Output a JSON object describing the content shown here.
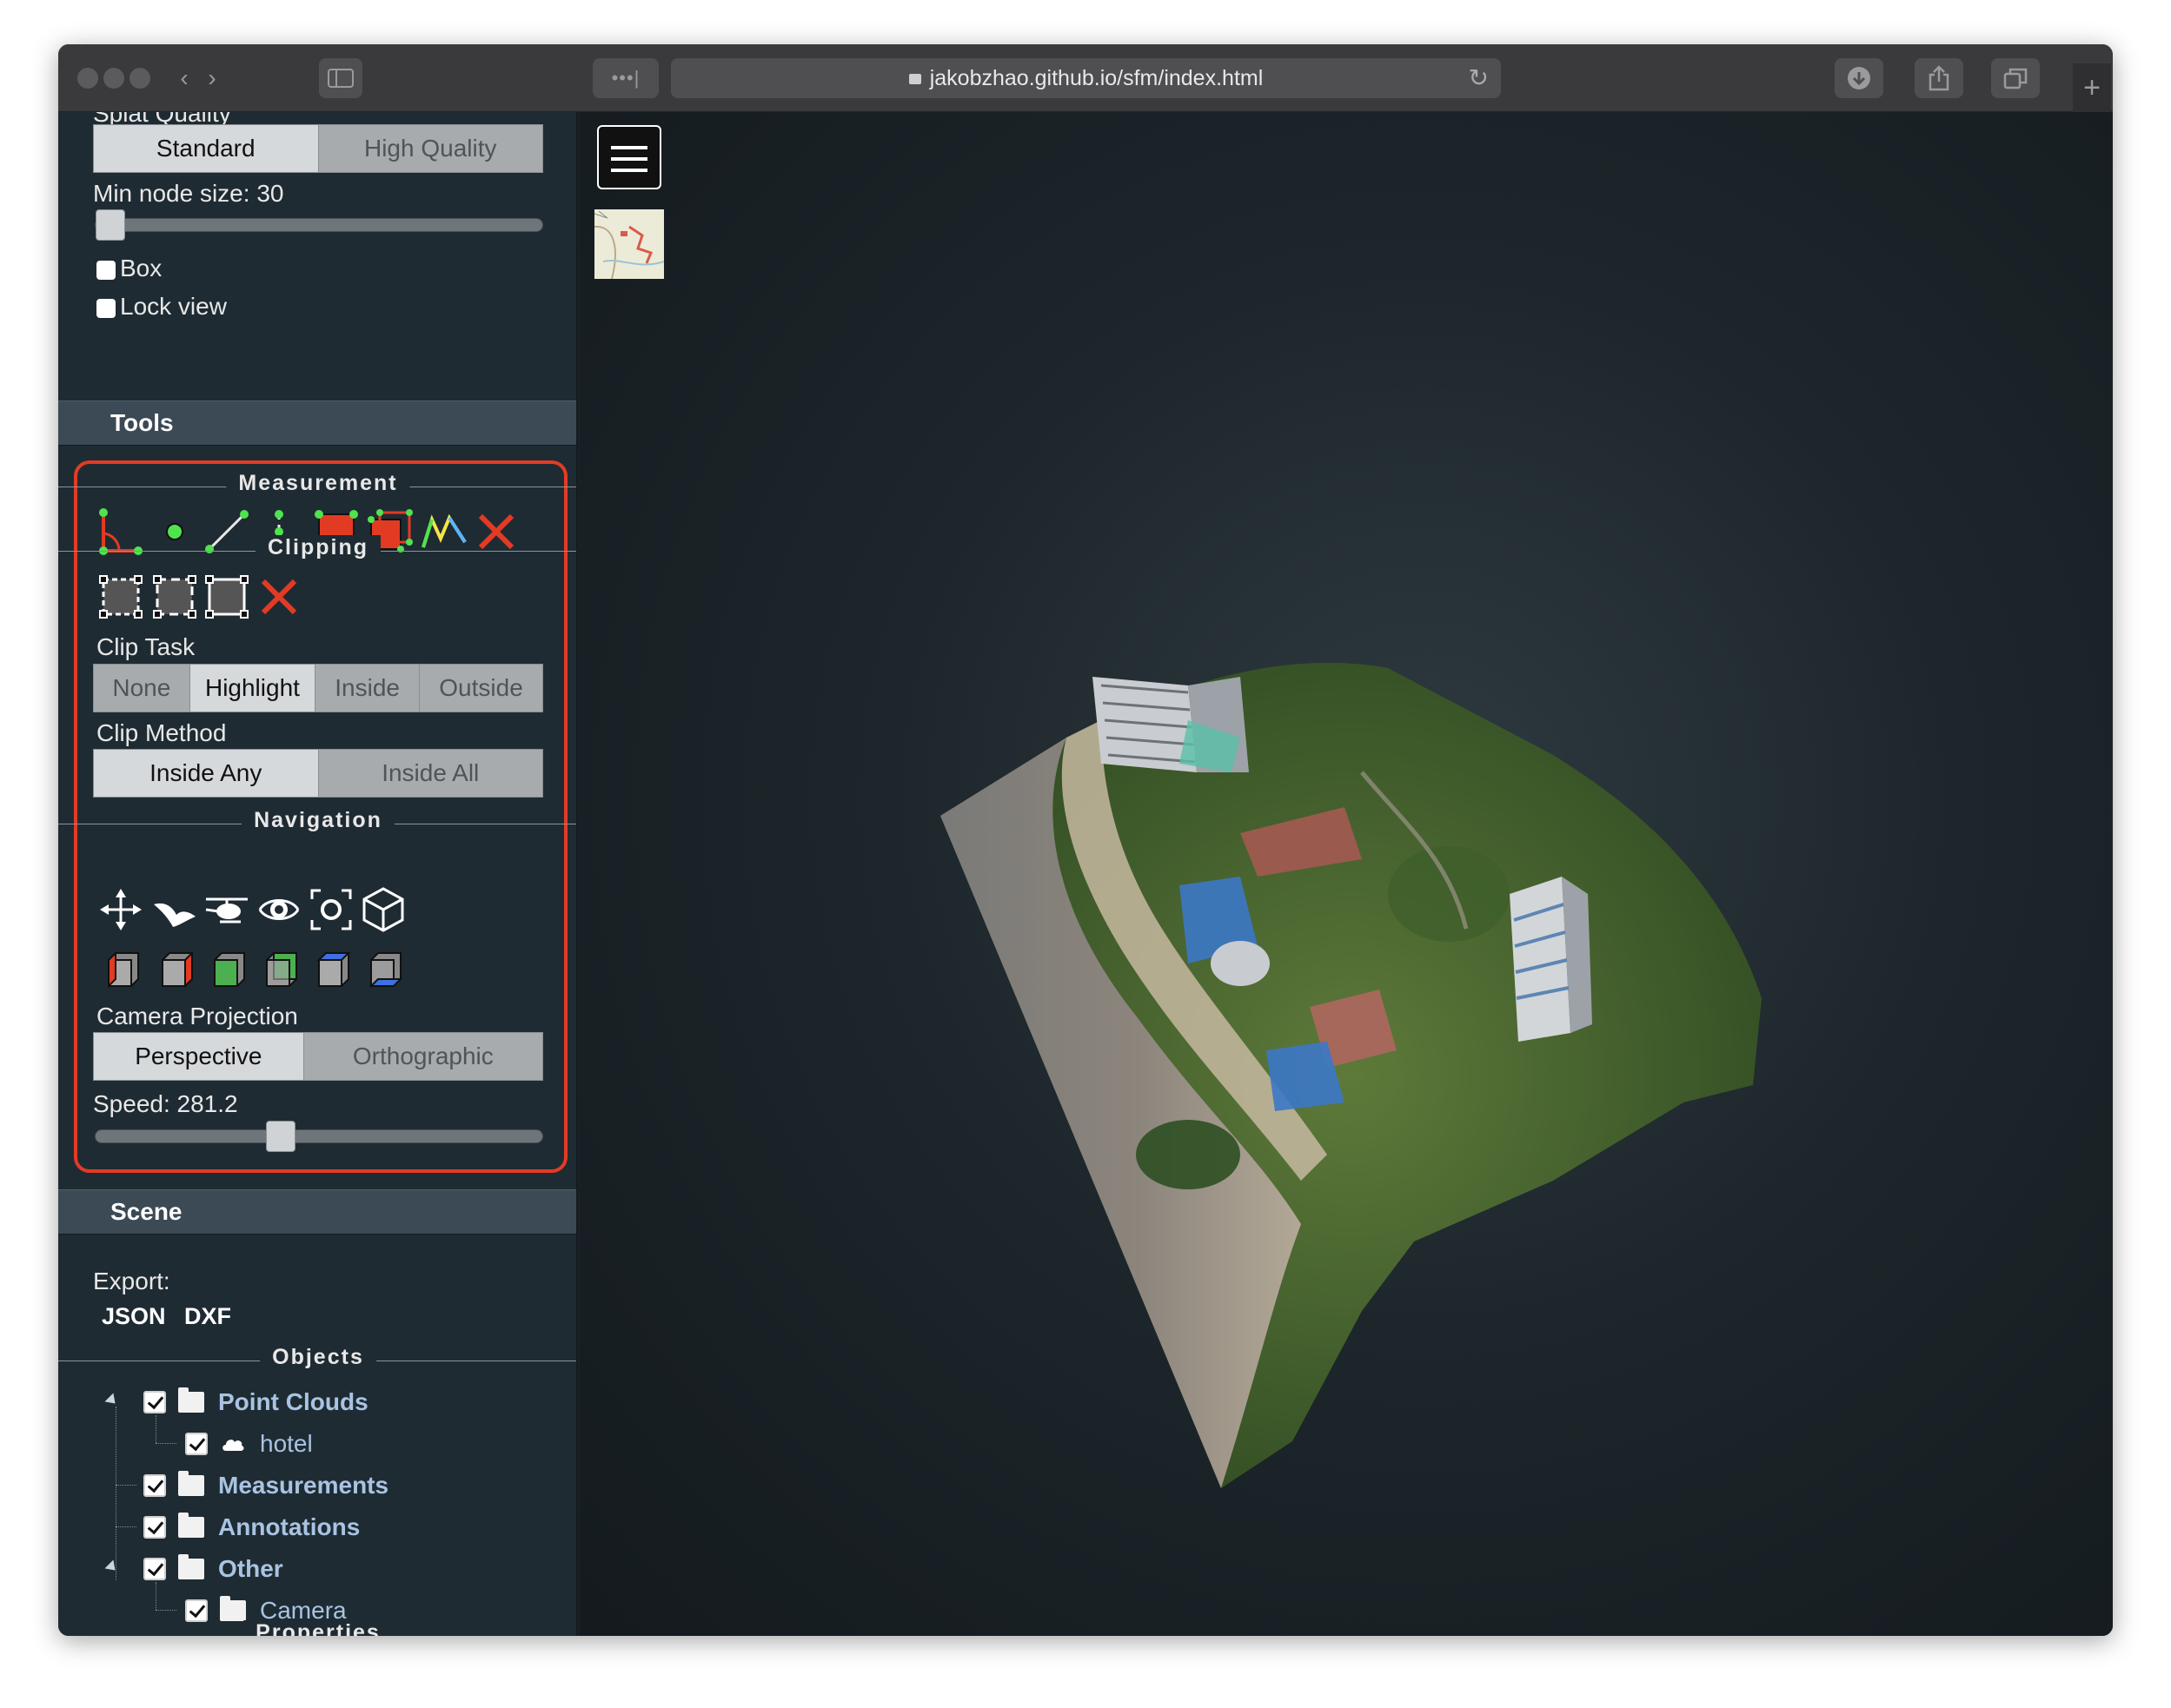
{
  "browser": {
    "url": "jakobzhao.github.io/sfm/index.html",
    "reader_icon": "•••|",
    "nav_back_icon": "‹",
    "nav_forward_icon": "›"
  },
  "sidebar": {
    "splat_quality": {
      "label": "Splat Quality",
      "options": [
        "Standard",
        "High Quality"
      ],
      "selected": "Standard"
    },
    "min_node_size": {
      "label": "Min node size: 30",
      "value": 30,
      "slider_fraction": 0.03
    },
    "box_label": "Box",
    "lock_view_label": "Lock view",
    "tools_header": "Tools",
    "measurement_title": "Measurement",
    "measurement_icons": [
      "angle-icon",
      "point-icon",
      "distance-icon",
      "height-icon",
      "area-icon",
      "volume-icon",
      "profile-icon",
      "remove-measurements-icon"
    ],
    "clipping_title": "Clipping",
    "clipping_icons": [
      "clip-volume-icon",
      "clip-polygon-icon",
      "clip-screen-box-icon",
      "remove-clipping-icon"
    ],
    "clip_task": {
      "label": "Clip Task",
      "options": [
        "None",
        "Highlight",
        "Inside",
        "Outside"
      ],
      "selected": "Highlight"
    },
    "clip_method": {
      "label": "Clip Method",
      "options": [
        "Inside Any",
        "Inside All"
      ],
      "selected": "Inside Any"
    },
    "navigation_title": "Navigation",
    "navigation_icons": [
      "earth-controls-icon",
      "fly-controls-icon",
      "helicopter-controls-icon",
      "orbit-controls-icon",
      "focus-icon",
      "navigation-cube-icon"
    ],
    "view_icons": [
      "left-view-icon",
      "right-view-icon",
      "front-view-icon",
      "back-view-icon",
      "top-view-icon",
      "bottom-view-icon"
    ],
    "camera_projection": {
      "label": "Camera Projection",
      "options": [
        "Perspective",
        "Orthographic"
      ],
      "selected": "Perspective"
    },
    "speed": {
      "label": "Speed: 281.2",
      "value": 281.2,
      "slider_fraction": 0.41
    },
    "scene_header": "Scene",
    "export_label": "Export:",
    "export_links": [
      "JSON",
      "DXF"
    ],
    "objects_title": "Objects",
    "tree": [
      {
        "label": "Point Clouds",
        "bold": true,
        "level": 0,
        "expanded": true
      },
      {
        "label": "hotel",
        "bold": false,
        "level": 1,
        "icon": "cloud-icon"
      },
      {
        "label": "Measurements",
        "bold": true,
        "level": 0
      },
      {
        "label": "Annotations",
        "bold": true,
        "level": 0
      },
      {
        "label": "Other",
        "bold": true,
        "level": 0,
        "expanded": true
      },
      {
        "label": "Camera",
        "bold": false,
        "level": 1
      }
    ],
    "properties_title": "Properties"
  },
  "colors": {
    "highlight_border": "#e23b24",
    "sidebar_bg": "#1f2b33",
    "section_header_bg": "#3b4a54",
    "tree_link": "#a9c4e2"
  }
}
